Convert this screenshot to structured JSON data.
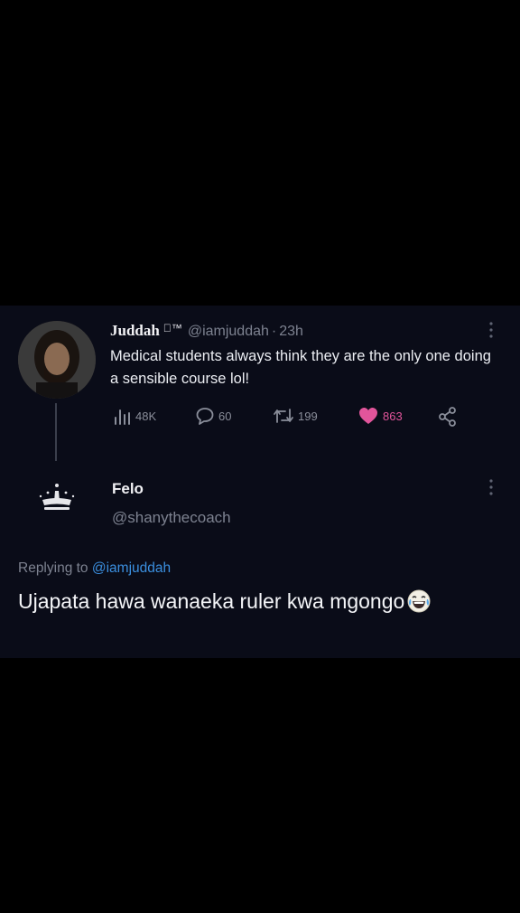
{
  "tweet": {
    "author_name": "Juddah",
    "author_badge": "™",
    "author_handle": "@iamjuddah",
    "separator": "·",
    "time": "23h",
    "text": "Medical students always think they are the only one doing a sensible course lol!",
    "stats": {
      "views": "48K",
      "replies": "60",
      "retweets": "199",
      "likes": "863"
    },
    "like_color": "#e2559b"
  },
  "reply": {
    "author_name": "Felo",
    "author_handle": "@shanythecoach",
    "replying_prefix": "Replying to",
    "replying_mention": "@iamjuddah",
    "text": "Ujapata hawa wanaeka ruler kwa mgongo",
    "mention_color": "#3b8fdf"
  },
  "icons": [
    "views-icon",
    "reply-icon",
    "retweet-icon",
    "heart-icon",
    "share-icon",
    "more-icon",
    "crown-avatar",
    "laughing-emoji-icon"
  ]
}
